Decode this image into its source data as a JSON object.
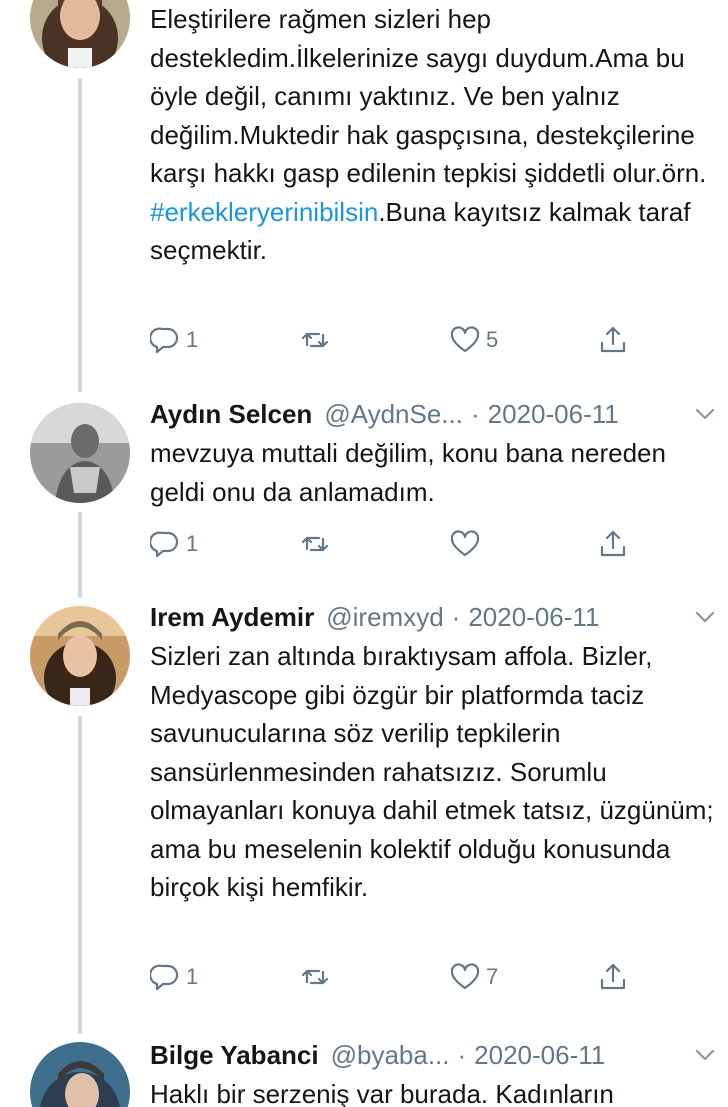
{
  "tweets": [
    {
      "has_header": false,
      "paragraph": [
        {
          "text": "Eleştirilere rağmen sizleri hep destekledim.İlkelerinize saygı duydum.Ama bu öyle değil, canımı yaktınız. Ve ben yalnız değilim.Muktedir hak gaspçısına, destekçilerine karşı hakkı gasp edilenin tepkisi şiddetli olur.örn. "
        },
        {
          "text": "#erkekleryerinibilsin",
          "hashtag": true
        },
        {
          "text": ".Buna kayıtsız kalmak taraf seçmektir."
        }
      ],
      "reply_count": "1",
      "retweet_count": "",
      "like_count": "5"
    },
    {
      "has_header": true,
      "name": "Aydın Selcen",
      "handle": "@AydnSe...",
      "separator": "·",
      "date": "2020-06-11",
      "text": "mevzuya muttali değilim, konu bana nereden geldi onu da anlamadım.",
      "reply_count": "1",
      "retweet_count": "",
      "like_count": ""
    },
    {
      "has_header": true,
      "name": "Irem Aydemir",
      "handle": "@iremxyd",
      "separator": "·",
      "date": "2020-06-11",
      "text": "Sizleri zan altında bıraktıysam affola. Bizler, Medyascope gibi özgür bir platformda taciz savunucularına söz verilip tepkilerin sansürlenmesinden rahatsızız. Sorumlu olmayanları konuya dahil etmek tatsız, üzgünüm; ama bu meselenin kolektif olduğu konusunda birçok kişi hemfikir.",
      "reply_count": "1",
      "retweet_count": "",
      "like_count": "7"
    },
    {
      "has_header": true,
      "name": "Bilge Yabanci",
      "handle": "@byaba...",
      "separator": "·",
      "date": "2020-06-11",
      "text": "Haklı bir serzeniş var burada. Kadınların"
    }
  ],
  "icons": {
    "reply": "reply-icon",
    "retweet": "retweet-icon",
    "like": "like-icon",
    "share": "share-icon",
    "more": "chevron-down-icon"
  },
  "colors": {
    "text": "#14171a",
    "secondary": "#657786",
    "hashtag": "#1b95e0",
    "thread_line": "#cfd9de"
  }
}
